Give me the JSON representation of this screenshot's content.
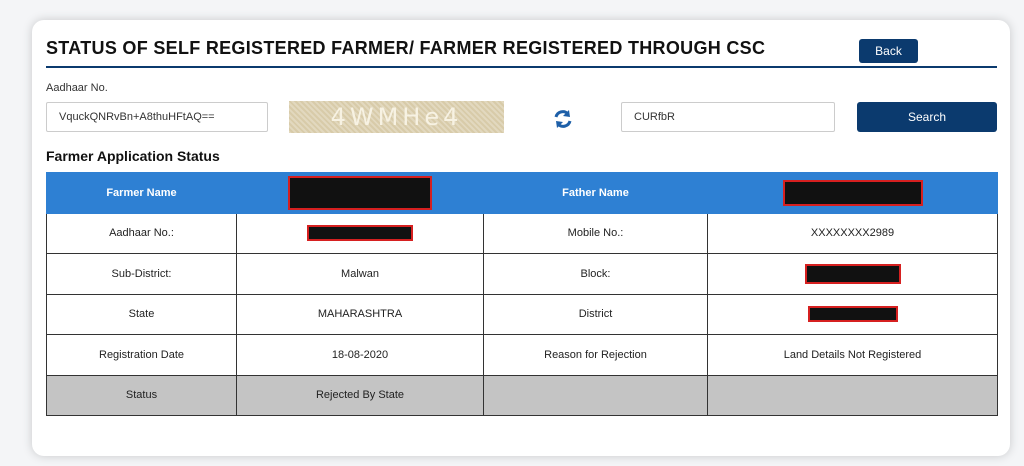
{
  "header": {
    "title": "STATUS OF SELF REGISTERED FARMER/ FARMER REGISTERED THROUGH CSC",
    "back_label": "Back"
  },
  "form": {
    "aadhaar_label": "Aadhaar No.",
    "aadhaar_value": "VquckQNRvBn+A8thuHFtAQ==",
    "captcha_text": "4WMHe4",
    "captcha_entry": "CURfbR",
    "search_label": "Search"
  },
  "section": {
    "title": "Farmer Application Status"
  },
  "table": {
    "header": {
      "farmer_name_label": "Farmer Name",
      "father_name_label": "Father Name"
    },
    "rows": [
      {
        "label1": "Aadhaar No.:",
        "value1": "",
        "label2": "Mobile No.:",
        "value2": "XXXXXXXX2989"
      },
      {
        "label1": "Sub-District:",
        "value1": "Malwan",
        "label2": "Block:",
        "value2": ""
      },
      {
        "label1": "State",
        "value1": "MAHARASHTRA",
        "label2": "District",
        "value2": ""
      },
      {
        "label1": "Registration Date",
        "value1": "18-08-2020",
        "label2": "Reason for Rejection",
        "value2": "Land Details Not Registered"
      }
    ],
    "status": {
      "label": "Status",
      "value": "Rejected By State"
    }
  },
  "colors": {
    "primary": "#0b3a6e",
    "table_header": "#2e80d3",
    "status_row": "#c4c4c4",
    "redaction_border": "#d62020"
  }
}
